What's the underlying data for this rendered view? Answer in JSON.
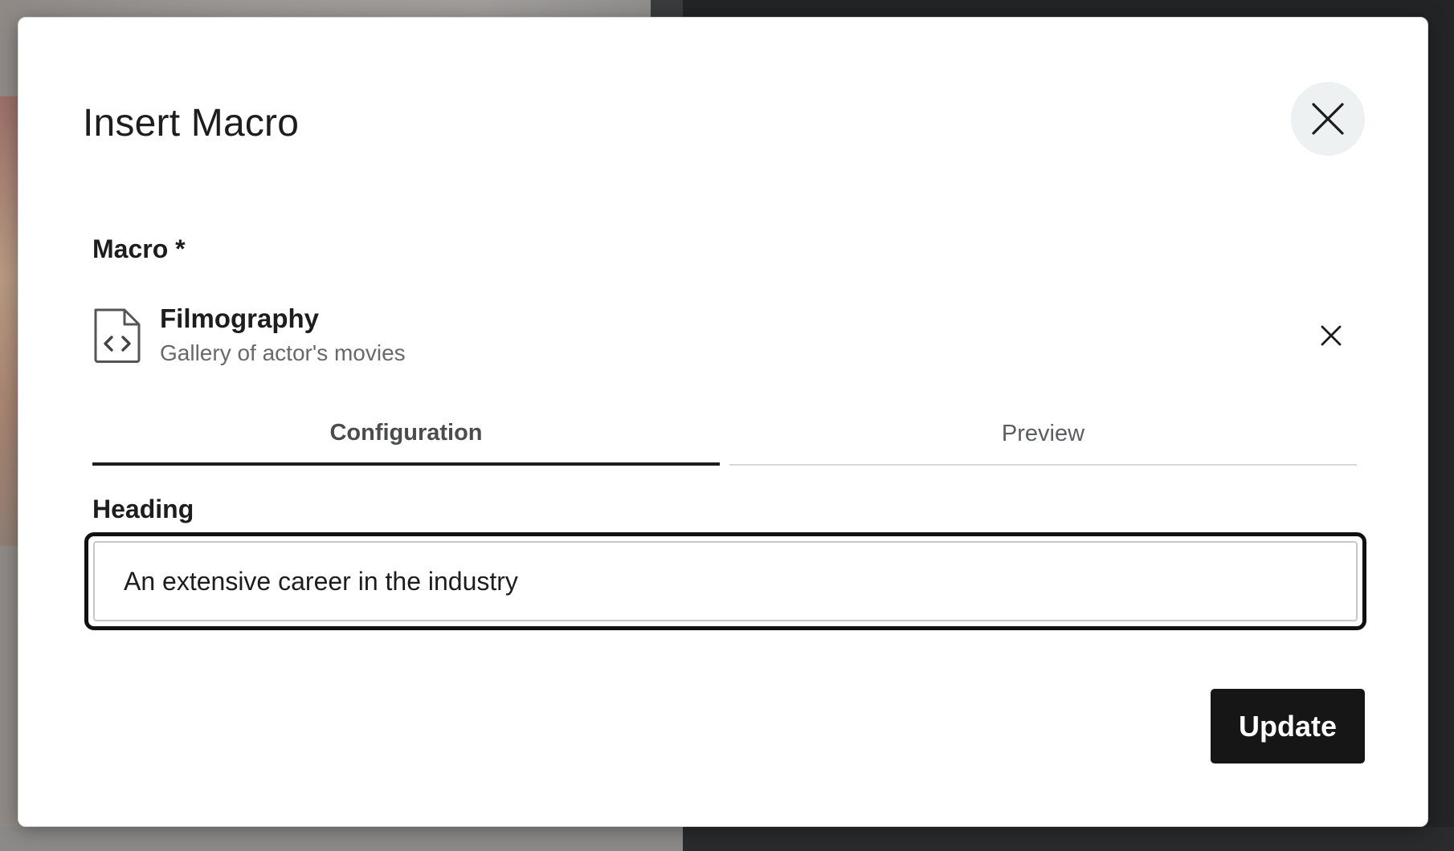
{
  "dialog": {
    "title": "Insert Macro",
    "close_icon": "close-icon"
  },
  "macro_field": {
    "label": "Macro *",
    "selected": {
      "icon": "code-file-icon",
      "name": "Filmography",
      "description": "Gallery of actor's movies",
      "remove_icon": "close-icon"
    }
  },
  "tabs": [
    {
      "label": "Configuration",
      "active": true
    },
    {
      "label": "Preview",
      "active": false
    }
  ],
  "heading_field": {
    "label": "Heading",
    "value": "An extensive career in the industry"
  },
  "actions": {
    "update_label": "Update"
  },
  "colors": {
    "primary_button": "#161616",
    "close_button_bg": "#eef1f1",
    "focus_ring": "#111111"
  }
}
